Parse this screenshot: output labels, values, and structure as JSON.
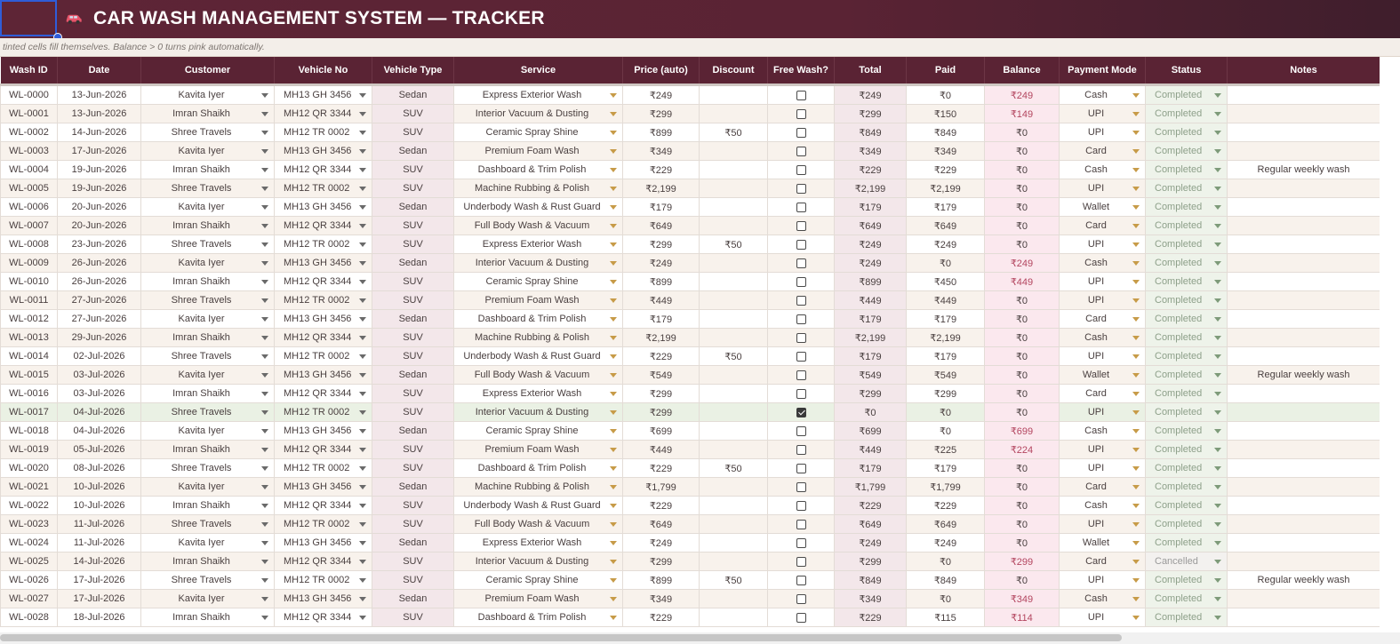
{
  "title_bar": {
    "title": "CAR WASH MANAGEMENT SYSTEM — TRACKER",
    "icon": "car-icon",
    "colors": {
      "bar": "#5a2334",
      "selection": "#2f5dd8"
    }
  },
  "hint": "tinted cells fill themselves. Balance > 0 turns pink automatically.",
  "columns": [
    "Wash ID",
    "Date",
    "Customer",
    "Vehicle No",
    "Vehicle Type",
    "Service",
    "Price (auto)",
    "Discount",
    "Free Wash?",
    "Total",
    "Paid",
    "Balance",
    "Payment Mode",
    "Status",
    "Notes"
  ],
  "rows": [
    {
      "id": "WL-0000",
      "date": "13-Jun-2026",
      "customer": "Kavita Iyer",
      "vehicle": "MH13 GH 3456",
      "type": "Sedan",
      "service": "Express Exterior Wash",
      "price": "₹249",
      "discount": "",
      "free": false,
      "total": "₹249",
      "paid": "₹0",
      "balance": "₹249",
      "mode": "Cash",
      "status": "Completed",
      "notes": ""
    },
    {
      "id": "WL-0001",
      "date": "13-Jun-2026",
      "customer": "Imran Shaikh",
      "vehicle": "MH12 QR 3344",
      "type": "SUV",
      "service": "Interior Vacuum & Dusting",
      "price": "₹299",
      "discount": "",
      "free": false,
      "total": "₹299",
      "paid": "₹150",
      "balance": "₹149",
      "mode": "UPI",
      "status": "Completed",
      "notes": ""
    },
    {
      "id": "WL-0002",
      "date": "14-Jun-2026",
      "customer": "Shree Travels",
      "vehicle": "MH12 TR 0002",
      "type": "SUV",
      "service": "Ceramic Spray Shine",
      "price": "₹899",
      "discount": "₹50",
      "free": false,
      "total": "₹849",
      "paid": "₹849",
      "balance": "₹0",
      "mode": "UPI",
      "status": "Completed",
      "notes": ""
    },
    {
      "id": "WL-0003",
      "date": "17-Jun-2026",
      "customer": "Kavita Iyer",
      "vehicle": "MH13 GH 3456",
      "type": "Sedan",
      "service": "Premium Foam Wash",
      "price": "₹349",
      "discount": "",
      "free": false,
      "total": "₹349",
      "paid": "₹349",
      "balance": "₹0",
      "mode": "Card",
      "status": "Completed",
      "notes": ""
    },
    {
      "id": "WL-0004",
      "date": "19-Jun-2026",
      "customer": "Imran Shaikh",
      "vehicle": "MH12 QR 3344",
      "type": "SUV",
      "service": "Dashboard & Trim Polish",
      "price": "₹229",
      "discount": "",
      "free": false,
      "total": "₹229",
      "paid": "₹229",
      "balance": "₹0",
      "mode": "Cash",
      "status": "Completed",
      "notes": "Regular weekly wash"
    },
    {
      "id": "WL-0005",
      "date": "19-Jun-2026",
      "customer": "Shree Travels",
      "vehicle": "MH12 TR 0002",
      "type": "SUV",
      "service": "Machine Rubbing & Polish",
      "price": "₹2,199",
      "discount": "",
      "free": false,
      "total": "₹2,199",
      "paid": "₹2,199",
      "balance": "₹0",
      "mode": "UPI",
      "status": "Completed",
      "notes": ""
    },
    {
      "id": "WL-0006",
      "date": "20-Jun-2026",
      "customer": "Kavita Iyer",
      "vehicle": "MH13 GH 3456",
      "type": "Sedan",
      "service": "Underbody Wash & Rust Guard",
      "price": "₹179",
      "discount": "",
      "free": false,
      "total": "₹179",
      "paid": "₹179",
      "balance": "₹0",
      "mode": "Wallet",
      "status": "Completed",
      "notes": ""
    },
    {
      "id": "WL-0007",
      "date": "20-Jun-2026",
      "customer": "Imran Shaikh",
      "vehicle": "MH12 QR 3344",
      "type": "SUV",
      "service": "Full Body Wash & Vacuum",
      "price": "₹649",
      "discount": "",
      "free": false,
      "total": "₹649",
      "paid": "₹649",
      "balance": "₹0",
      "mode": "Card",
      "status": "Completed",
      "notes": ""
    },
    {
      "id": "WL-0008",
      "date": "23-Jun-2026",
      "customer": "Shree Travels",
      "vehicle": "MH12 TR 0002",
      "type": "SUV",
      "service": "Express Exterior Wash",
      "price": "₹299",
      "discount": "₹50",
      "free": false,
      "total": "₹249",
      "paid": "₹249",
      "balance": "₹0",
      "mode": "UPI",
      "status": "Completed",
      "notes": ""
    },
    {
      "id": "WL-0009",
      "date": "26-Jun-2026",
      "customer": "Kavita Iyer",
      "vehicle": "MH13 GH 3456",
      "type": "Sedan",
      "service": "Interior Vacuum & Dusting",
      "price": "₹249",
      "discount": "",
      "free": false,
      "total": "₹249",
      "paid": "₹0",
      "balance": "₹249",
      "mode": "Cash",
      "status": "Completed",
      "notes": ""
    },
    {
      "id": "WL-0010",
      "date": "26-Jun-2026",
      "customer": "Imran Shaikh",
      "vehicle": "MH12 QR 3344",
      "type": "SUV",
      "service": "Ceramic Spray Shine",
      "price": "₹899",
      "discount": "",
      "free": false,
      "total": "₹899",
      "paid": "₹450",
      "balance": "₹449",
      "mode": "UPI",
      "status": "Completed",
      "notes": ""
    },
    {
      "id": "WL-0011",
      "date": "27-Jun-2026",
      "customer": "Shree Travels",
      "vehicle": "MH12 TR 0002",
      "type": "SUV",
      "service": "Premium Foam Wash",
      "price": "₹449",
      "discount": "",
      "free": false,
      "total": "₹449",
      "paid": "₹449",
      "balance": "₹0",
      "mode": "UPI",
      "status": "Completed",
      "notes": ""
    },
    {
      "id": "WL-0012",
      "date": "27-Jun-2026",
      "customer": "Kavita Iyer",
      "vehicle": "MH13 GH 3456",
      "type": "Sedan",
      "service": "Dashboard & Trim Polish",
      "price": "₹179",
      "discount": "",
      "free": false,
      "total": "₹179",
      "paid": "₹179",
      "balance": "₹0",
      "mode": "Card",
      "status": "Completed",
      "notes": ""
    },
    {
      "id": "WL-0013",
      "date": "29-Jun-2026",
      "customer": "Imran Shaikh",
      "vehicle": "MH12 QR 3344",
      "type": "SUV",
      "service": "Machine Rubbing & Polish",
      "price": "₹2,199",
      "discount": "",
      "free": false,
      "total": "₹2,199",
      "paid": "₹2,199",
      "balance": "₹0",
      "mode": "Cash",
      "status": "Completed",
      "notes": ""
    },
    {
      "id": "WL-0014",
      "date": "02-Jul-2026",
      "customer": "Shree Travels",
      "vehicle": "MH12 TR 0002",
      "type": "SUV",
      "service": "Underbody Wash & Rust Guard",
      "price": "₹229",
      "discount": "₹50",
      "free": false,
      "total": "₹179",
      "paid": "₹179",
      "balance": "₹0",
      "mode": "UPI",
      "status": "Completed",
      "notes": ""
    },
    {
      "id": "WL-0015",
      "date": "03-Jul-2026",
      "customer": "Kavita Iyer",
      "vehicle": "MH13 GH 3456",
      "type": "Sedan",
      "service": "Full Body Wash & Vacuum",
      "price": "₹549",
      "discount": "",
      "free": false,
      "total": "₹549",
      "paid": "₹549",
      "balance": "₹0",
      "mode": "Wallet",
      "status": "Completed",
      "notes": "Regular weekly wash"
    },
    {
      "id": "WL-0016",
      "date": "03-Jul-2026",
      "customer": "Imran Shaikh",
      "vehicle": "MH12 QR 3344",
      "type": "SUV",
      "service": "Express Exterior Wash",
      "price": "₹299",
      "discount": "",
      "free": false,
      "total": "₹299",
      "paid": "₹299",
      "balance": "₹0",
      "mode": "Card",
      "status": "Completed",
      "notes": ""
    },
    {
      "id": "WL-0017",
      "date": "04-Jul-2026",
      "customer": "Shree Travels",
      "vehicle": "MH12 TR 0002",
      "type": "SUV",
      "service": "Interior Vacuum & Dusting",
      "price": "₹299",
      "discount": "",
      "free": true,
      "total": "₹0",
      "paid": "₹0",
      "balance": "₹0",
      "mode": "UPI",
      "status": "Completed",
      "notes": ""
    },
    {
      "id": "WL-0018",
      "date": "04-Jul-2026",
      "customer": "Kavita Iyer",
      "vehicle": "MH13 GH 3456",
      "type": "Sedan",
      "service": "Ceramic Spray Shine",
      "price": "₹699",
      "discount": "",
      "free": false,
      "total": "₹699",
      "paid": "₹0",
      "balance": "₹699",
      "mode": "Cash",
      "status": "Completed",
      "notes": ""
    },
    {
      "id": "WL-0019",
      "date": "05-Jul-2026",
      "customer": "Imran Shaikh",
      "vehicle": "MH12 QR 3344",
      "type": "SUV",
      "service": "Premium Foam Wash",
      "price": "₹449",
      "discount": "",
      "free": false,
      "total": "₹449",
      "paid": "₹225",
      "balance": "₹224",
      "mode": "UPI",
      "status": "Completed",
      "notes": ""
    },
    {
      "id": "WL-0020",
      "date": "08-Jul-2026",
      "customer": "Shree Travels",
      "vehicle": "MH12 TR 0002",
      "type": "SUV",
      "service": "Dashboard & Trim Polish",
      "price": "₹229",
      "discount": "₹50",
      "free": false,
      "total": "₹179",
      "paid": "₹179",
      "balance": "₹0",
      "mode": "UPI",
      "status": "Completed",
      "notes": ""
    },
    {
      "id": "WL-0021",
      "date": "10-Jul-2026",
      "customer": "Kavita Iyer",
      "vehicle": "MH13 GH 3456",
      "type": "Sedan",
      "service": "Machine Rubbing & Polish",
      "price": "₹1,799",
      "discount": "",
      "free": false,
      "total": "₹1,799",
      "paid": "₹1,799",
      "balance": "₹0",
      "mode": "Card",
      "status": "Completed",
      "notes": ""
    },
    {
      "id": "WL-0022",
      "date": "10-Jul-2026",
      "customer": "Imran Shaikh",
      "vehicle": "MH12 QR 3344",
      "type": "SUV",
      "service": "Underbody Wash & Rust Guard",
      "price": "₹229",
      "discount": "",
      "free": false,
      "total": "₹229",
      "paid": "₹229",
      "balance": "₹0",
      "mode": "Cash",
      "status": "Completed",
      "notes": ""
    },
    {
      "id": "WL-0023",
      "date": "11-Jul-2026",
      "customer": "Shree Travels",
      "vehicle": "MH12 TR 0002",
      "type": "SUV",
      "service": "Full Body Wash & Vacuum",
      "price": "₹649",
      "discount": "",
      "free": false,
      "total": "₹649",
      "paid": "₹649",
      "balance": "₹0",
      "mode": "UPI",
      "status": "Completed",
      "notes": ""
    },
    {
      "id": "WL-0024",
      "date": "11-Jul-2026",
      "customer": "Kavita Iyer",
      "vehicle": "MH13 GH 3456",
      "type": "Sedan",
      "service": "Express Exterior Wash",
      "price": "₹249",
      "discount": "",
      "free": false,
      "total": "₹249",
      "paid": "₹249",
      "balance": "₹0",
      "mode": "Wallet",
      "status": "Completed",
      "notes": ""
    },
    {
      "id": "WL-0025",
      "date": "14-Jul-2026",
      "customer": "Imran Shaikh",
      "vehicle": "MH12 QR 3344",
      "type": "SUV",
      "service": "Interior Vacuum & Dusting",
      "price": "₹299",
      "discount": "",
      "free": false,
      "total": "₹299",
      "paid": "₹0",
      "balance": "₹299",
      "mode": "Card",
      "status": "Cancelled",
      "notes": ""
    },
    {
      "id": "WL-0026",
      "date": "17-Jul-2026",
      "customer": "Shree Travels",
      "vehicle": "MH12 TR 0002",
      "type": "SUV",
      "service": "Ceramic Spray Shine",
      "price": "₹899",
      "discount": "₹50",
      "free": false,
      "total": "₹849",
      "paid": "₹849",
      "balance": "₹0",
      "mode": "UPI",
      "status": "Completed",
      "notes": "Regular weekly wash"
    },
    {
      "id": "WL-0027",
      "date": "17-Jul-2026",
      "customer": "Kavita Iyer",
      "vehicle": "MH13 GH 3456",
      "type": "Sedan",
      "service": "Premium Foam Wash",
      "price": "₹349",
      "discount": "",
      "free": false,
      "total": "₹349",
      "paid": "₹0",
      "balance": "₹349",
      "mode": "Cash",
      "status": "Completed",
      "notes": ""
    },
    {
      "id": "WL-0028",
      "date": "18-Jul-2026",
      "customer": "Imran Shaikh",
      "vehicle": "MH12 QR 3344",
      "type": "SUV",
      "service": "Dashboard & Trim Polish",
      "price": "₹229",
      "discount": "",
      "free": false,
      "total": "₹229",
      "paid": "₹115",
      "balance": "₹114",
      "mode": "UPI",
      "status": "Completed",
      "notes": ""
    }
  ]
}
